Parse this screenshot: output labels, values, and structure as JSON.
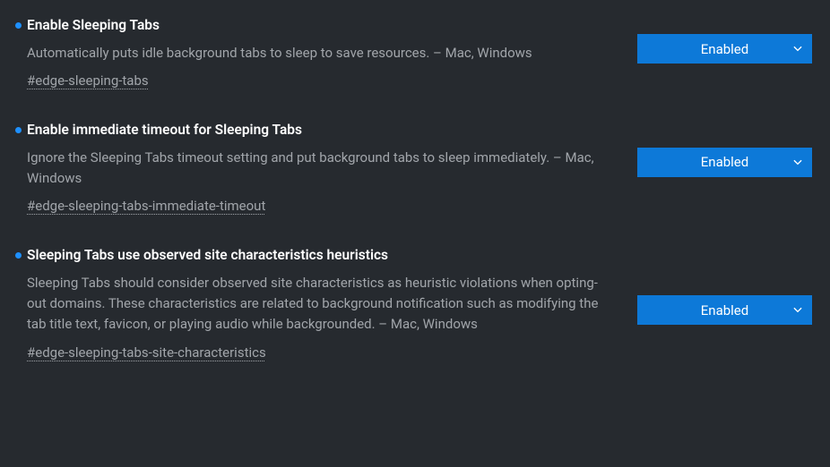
{
  "flags": [
    {
      "title": "Enable Sleeping Tabs",
      "description": "Automatically puts idle background tabs to sleep to save resources. – Mac, Windows",
      "anchor": "#edge-sleeping-tabs",
      "select_value": "Enabled"
    },
    {
      "title": "Enable immediate timeout for Sleeping Tabs",
      "description": "Ignore the Sleeping Tabs timeout setting and put background tabs to sleep immediately. – Mac, Windows",
      "anchor": "#edge-sleeping-tabs-immediate-timeout",
      "select_value": "Enabled"
    },
    {
      "title": "Sleeping Tabs use observed site characteristics heuristics",
      "description": "Sleeping Tabs should consider observed site characteristics as heuristic violations when opting-out domains. These characteristics are related to background notification such as modifying the tab title text, favicon, or playing audio while backgrounded. – Mac, Windows",
      "anchor": "#edge-sleeping-tabs-site-characteristics",
      "select_value": "Enabled"
    }
  ]
}
